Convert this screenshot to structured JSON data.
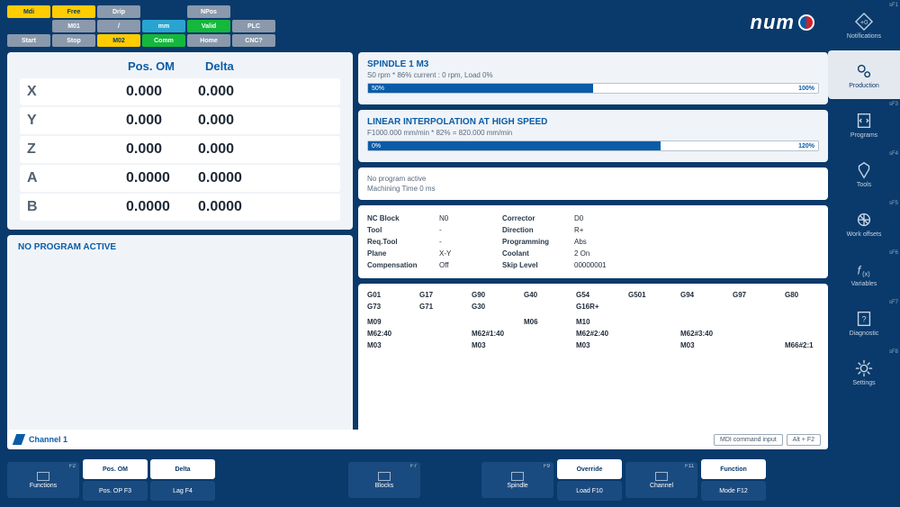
{
  "topbar": {
    "buttons": [
      [
        "Mdi",
        "Free",
        "Drip",
        "",
        "NPos",
        "",
        ""
      ],
      [
        "",
        "M01",
        "/",
        "mm",
        "Valid",
        "PLC",
        ""
      ],
      [
        "Start",
        "Stop",
        "M02",
        "Comm",
        "Home",
        "CNC?",
        ""
      ]
    ],
    "styles": [
      [
        "yellow",
        "yellow",
        "grey",
        "empty",
        "grey",
        "empty",
        "empty"
      ],
      [
        "empty",
        "grey",
        "grey",
        "blue",
        "green",
        "grey",
        "empty"
      ],
      [
        "grey",
        "grey",
        "yellow",
        "green",
        "grey",
        "grey",
        "empty"
      ]
    ]
  },
  "logo": "num",
  "sidenav": [
    {
      "label": "Notifications",
      "key": "sF1",
      "icon": "bell"
    },
    {
      "label": "Production",
      "key": "",
      "icon": "gears",
      "active": true
    },
    {
      "label": "Programs",
      "key": "sF3",
      "icon": "code"
    },
    {
      "label": "Tools",
      "key": "sF4",
      "icon": "tool"
    },
    {
      "label": "Work offsets",
      "key": "sF5",
      "icon": "offset"
    },
    {
      "label": "Variables",
      "key": "sF6",
      "icon": "fx"
    },
    {
      "label": "Diagnostic",
      "key": "sF7",
      "icon": "diag"
    },
    {
      "label": "Settings",
      "key": "sF8",
      "icon": "gear"
    }
  ],
  "position": {
    "header": [
      "",
      "Pos. OM",
      "Delta"
    ],
    "rows": [
      {
        "axis": "X",
        "om": "0.000",
        "delta": "0.000"
      },
      {
        "axis": "Y",
        "om": "0.000",
        "delta": "0.000"
      },
      {
        "axis": "Z",
        "om": "0.000",
        "delta": "0.000"
      },
      {
        "axis": "A",
        "om": "0.0000",
        "delta": "0.0000"
      },
      {
        "axis": "B",
        "om": "0.0000",
        "delta": "0.0000"
      }
    ]
  },
  "program_status": "NO PROGRAM ACTIVE",
  "spindle": {
    "title": "SPINDLE 1 M3",
    "sub": "S0 rpm * 86% current : 0 rpm, Load 0%",
    "bar_fill": "50%",
    "bar_lbl": "100%",
    "fill_w": "50%"
  },
  "interp": {
    "title": "LINEAR INTERPOLATION AT HIGH SPEED",
    "sub": "F1000.000 mm/min * 82% = 820.000 mm/min",
    "bar_fill": "0%",
    "bar_lbl": "120%",
    "fill_w": "65%"
  },
  "noprog": [
    "No program active",
    "Machining Time 0 ms"
  ],
  "nc": [
    {
      "l": "NC Block",
      "v": "N0",
      "l2": "Corrector",
      "v2": "D0"
    },
    {
      "l": "Tool",
      "v": "-",
      "l2": "Direction",
      "v2": "R+"
    },
    {
      "l": "Req.Tool",
      "v": "-",
      "l2": "Programming",
      "v2": "Abs"
    },
    {
      "l": "Plane",
      "v": "X-Y",
      "l2": "Coolant",
      "v2": "2 On"
    },
    {
      "l": "Compensation",
      "v": "Off",
      "l2": "Skip Level",
      "v2": "00000001"
    }
  ],
  "gcodes": [
    [
      "G01",
      "G17",
      "G90",
      "G40",
      "G54",
      "G501",
      "G94",
      "G97",
      "G80"
    ],
    [
      "G73",
      "G71",
      "G30",
      "",
      "G16R+",
      "",
      "",
      "",
      ""
    ],
    [
      "",
      "",
      "",
      "",
      "",
      "",
      "",
      "",
      ""
    ],
    [
      "M09",
      "",
      "",
      "M06",
      "M10",
      "",
      "",
      "",
      ""
    ],
    [
      "M62:40",
      "",
      "M62#1:40",
      "",
      "M62#2:40",
      "",
      "M62#3:40",
      "",
      ""
    ],
    [
      "M03",
      "",
      "M03",
      "",
      "M03",
      "",
      "M03",
      "",
      "M66#2:1"
    ]
  ],
  "channel": {
    "label": "Channel 1",
    "mdi": "MDI command input",
    "hint": "Alt + F2"
  },
  "bottom": {
    "functions": {
      "label": "Functions",
      "key": "F2"
    },
    "pos_om": "Pos. OM",
    "delta": "Delta",
    "pos_op": "Pos. OP F3",
    "lag": "Lag F4",
    "blocks": {
      "label": "Blocks",
      "key": "F7"
    },
    "spindle": {
      "label": "Spindle",
      "key": "F9"
    },
    "override": "Override",
    "load": "Load F10",
    "channel": {
      "label": "Channel",
      "key": "F11"
    },
    "function": {
      "label": "Function"
    },
    "mode": "Mode F12"
  }
}
